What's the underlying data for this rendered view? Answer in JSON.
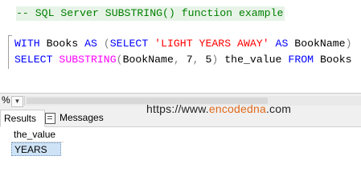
{
  "editor": {
    "line1": "-- SQL Server SUBSTRING() function example",
    "line2": {
      "kw_with": "WITH",
      "ident_books": "Books",
      "kw_as1": "AS",
      "paren_open": "(",
      "kw_select": "SELECT",
      "str_value": "'LIGHT YEARS AWAY'",
      "kw_as2": "AS",
      "ident_bookname": "BookName",
      "paren_close": ")"
    },
    "line3": {
      "kw_select": "SELECT",
      "fn_substring": "SUBSTRING",
      "paren_open": "(",
      "arg_col": "BookName",
      "comma1": ",",
      "arg_start": "7",
      "comma2": ",",
      "arg_len": "5",
      "paren_close": ")",
      "alias": "the_value",
      "kw_from": "FROM",
      "table": "Books"
    }
  },
  "statusbar": {
    "zoom_label": "%",
    "dropdown_glyph": "▼"
  },
  "results": {
    "tabs": [
      {
        "label": "Results"
      },
      {
        "label": "Messages"
      }
    ],
    "columns": [
      "the_value"
    ],
    "rows": [
      [
        "YEARS"
      ]
    ]
  },
  "watermark": {
    "prefix": "https://www.",
    "brand": "encodedna",
    "suffix": ".com"
  }
}
